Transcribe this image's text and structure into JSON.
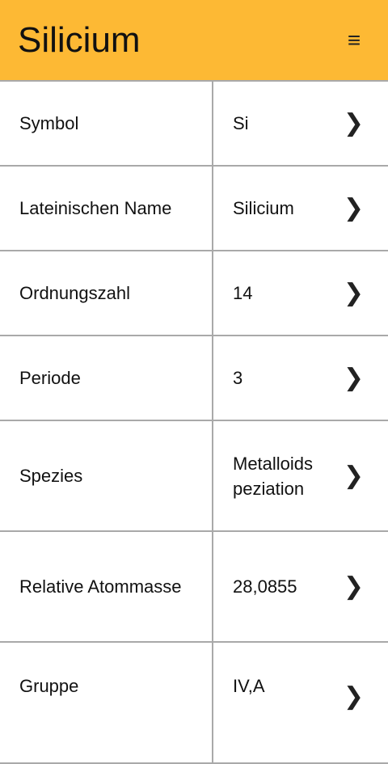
{
  "header": {
    "title": "Silicium",
    "menu_icon": "≡"
  },
  "rows": [
    {
      "label": "Symbol",
      "value": "Si",
      "chevron": "❯"
    },
    {
      "label": "Lateinischen Name",
      "value": "Silicium",
      "chevron": "❯"
    },
    {
      "label": "Ordnungszahl",
      "value": "14",
      "chevron": "❯"
    },
    {
      "label": "Periode",
      "value": "3",
      "chevron": "❯"
    },
    {
      "label": "Spezies",
      "value": "Metalloids peziation",
      "chevron": "❯"
    },
    {
      "label": "Relative Atommasse",
      "value": "28,0855",
      "chevron": "❯"
    },
    {
      "label": "Gruppe",
      "value": "IV,A",
      "chevron": "❯"
    }
  ],
  "colors": {
    "header_bg": "#FDB934",
    "divider": "#a9a9a9",
    "text": "#111111"
  }
}
